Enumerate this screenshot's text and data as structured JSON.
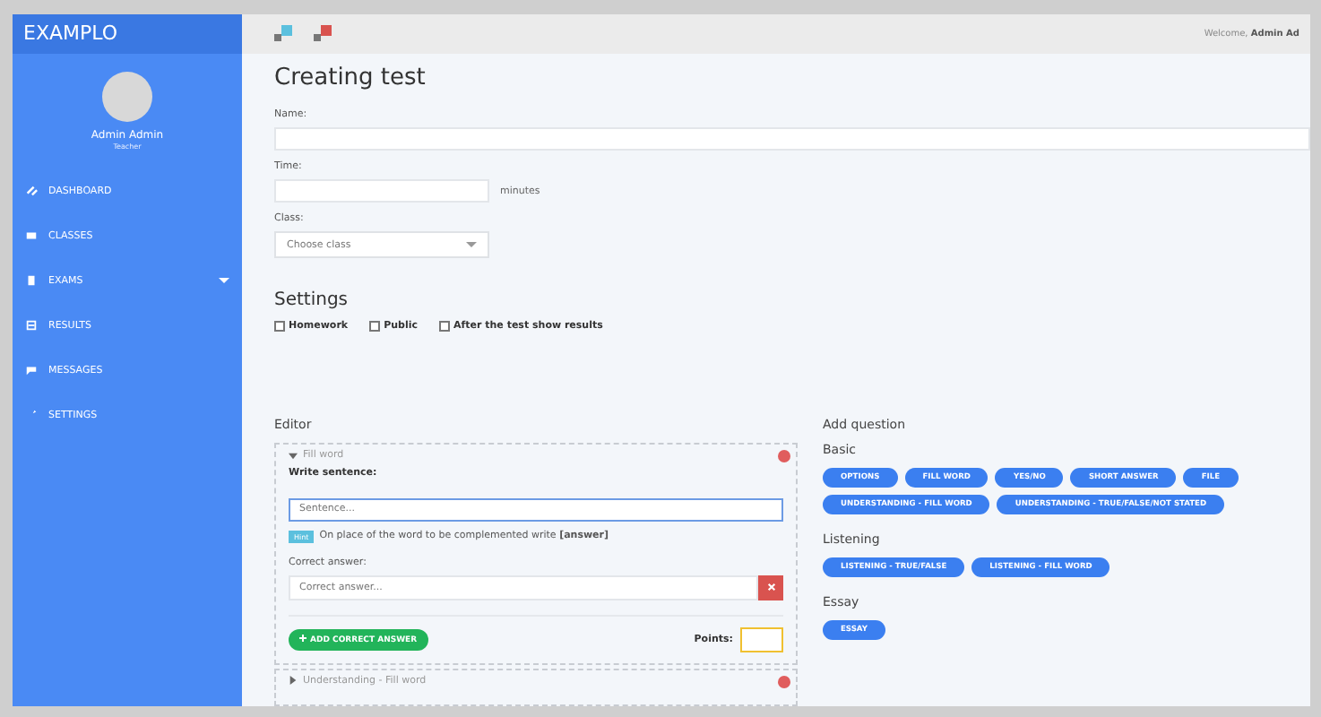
{
  "sidebar": {
    "brand": "EXAMPLO",
    "user": {
      "name": "Admin Admin",
      "role": "Teacher"
    },
    "items": [
      {
        "label": "DASHBOARD",
        "expandable": false
      },
      {
        "label": "CLASSES",
        "expandable": false
      },
      {
        "label": "EXAMS",
        "expandable": true
      },
      {
        "label": "RESULTS",
        "expandable": false
      },
      {
        "label": "MESSAGES",
        "expandable": false
      },
      {
        "label": "SETTINGS",
        "expandable": false
      }
    ]
  },
  "topbar": {
    "notifications": [
      {
        "color": "#5bc0de"
      },
      {
        "color": "#d9534f"
      }
    ],
    "welcome": "Welcome,",
    "welcome_name": "Admin Ad"
  },
  "title": "Creating test",
  "form": {
    "name_label": "Name:",
    "time_label": "Time:",
    "time_unit": "minutes",
    "class_label": "Class:",
    "class_placeholder": "Choose class"
  },
  "settings": {
    "title": "Settings",
    "options": [
      {
        "label": "Homework",
        "checked": false
      },
      {
        "label": "Public",
        "checked": false
      },
      {
        "label": "After the test show results",
        "checked": false
      }
    ]
  },
  "editor": {
    "title": "Editor",
    "blocks": [
      {
        "title": "Fill word",
        "expanded": true,
        "sentence_label": "Write sentence:",
        "sentence_placeholder": "Sentence...",
        "hint_badge": "Hint",
        "hint": "On place of the word to be complemented write **[answer]**",
        "answer_label": "Correct answer:",
        "answer_placeholder": "Correct answer...",
        "add_button": "ADD CORRECT ANSWER",
        "points_label": "Points:"
      },
      {
        "title": "Understanding - Fill word",
        "expanded": false
      }
    ]
  },
  "add_question": {
    "title": "Add question",
    "groups": [
      {
        "title": "Basic",
        "buttons": [
          "OPTIONS",
          "FILL WORD",
          "YES/NO",
          "SHORT ANSWER",
          "FILE",
          "UNDERSTANDING - FILL WORD",
          "UNDERSTANDING - TRUE/FALSE/NOT STATED"
        ]
      },
      {
        "title": "Listening",
        "buttons": [
          "LISTENING - TRUE/FALSE",
          "LISTENING - FILL WORD"
        ]
      },
      {
        "title": "Essay",
        "buttons": [
          "ESSAY"
        ]
      }
    ]
  }
}
